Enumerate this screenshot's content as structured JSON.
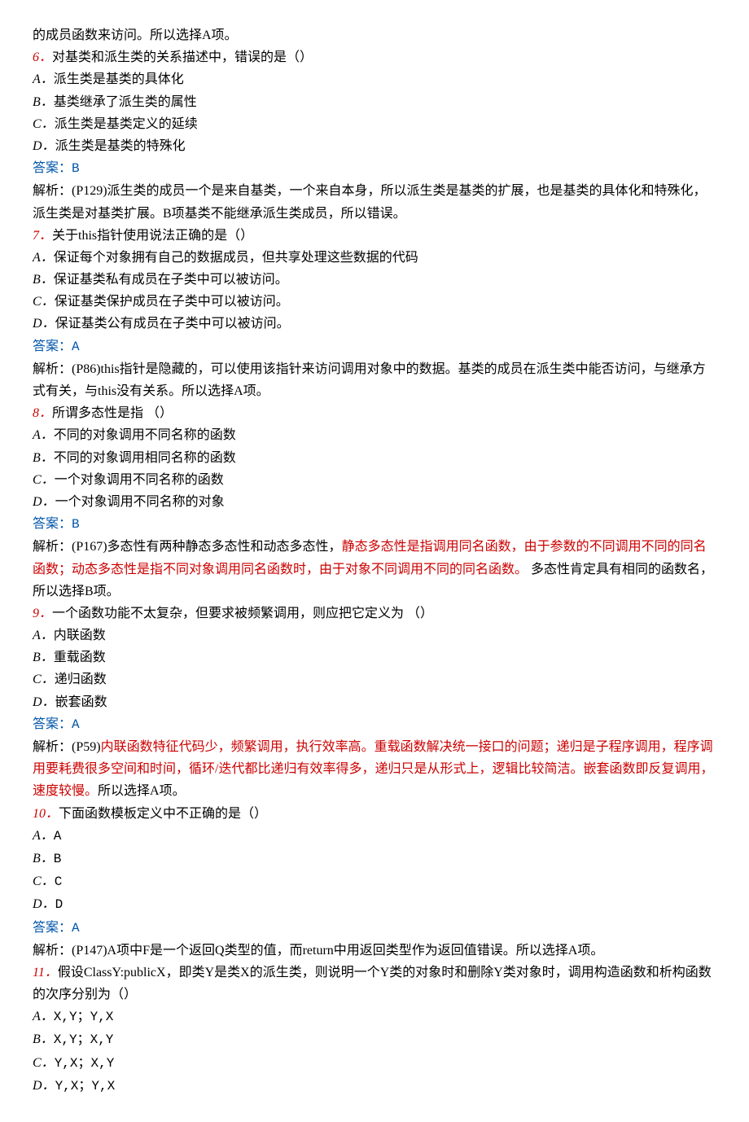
{
  "intro_tail": "的成员函数来访问。所以选择A项。",
  "q6": {
    "num": "6．",
    "stem": "对基类和派生类的关系描述中，错误的是（）",
    "A": "派生类是基类的具体化",
    "B": "基类继承了派生类的属性",
    "C": "派生类是基类定义的延续",
    "D": "派生类是基类的特殊化",
    "ans_label": "答案：",
    "ans_val": "B",
    "exp": "解析：(P129)派生类的成员一个是来自基类，一个来自本身，所以派生类是基类的扩展，也是基类的具体化和特殊化，派生类是对基类扩展。B项基类不能继承派生类成员，所以错误。"
  },
  "q7": {
    "num": "7．",
    "stem": "关于this指针使用说法正确的是（）",
    "A": "保证每个对象拥有自己的数据成员，但共享处理这些数据的代码",
    "B": "保证基类私有成员在子类中可以被访问。",
    "C": "保证基类保护成员在子类中可以被访问。",
    "D": "保证基类公有成员在子类中可以被访问。",
    "ans_label": "答案：",
    "ans_val": "A",
    "exp": "解析：(P86)this指针是隐藏的，可以使用该指针来访问调用对象中的数据。基类的成员在派生类中能否访问，与继承方式有关，与this没有关系。所以选择A项。"
  },
  "q8": {
    "num": "8．",
    "stem": "所谓多态性是指 （）",
    "A": "不同的对象调用不同名称的函数",
    "B": "不同的对象调用相同名称的函数",
    "C": "一个对象调用不同名称的函数",
    "D": "一个对象调用不同名称的对象",
    "ans_label": "答案：",
    "ans_val": "B",
    "exp_pre": "解析：(P167)多态性有两种静态多态性和动态多态性，",
    "exp_red": "静态多态性是指调用同名函数，由于参数的不同调用不同的同名函数；动态多态性是指不同对象调用同名函数时，由于对象不同调用不同的同名函数。",
    "exp_post": " 多态性肯定具有相同的函数名，所以选择B项。"
  },
  "q9": {
    "num": "9．",
    "stem": "一个函数功能不太复杂，但要求被频繁调用，则应把它定义为 （）",
    "A": "内联函数",
    "B": "重载函数",
    "C": "递归函数",
    "D": "嵌套函数",
    "ans_label": "答案：",
    "ans_val": "A",
    "exp_pre": "解析：(P59)",
    "exp_red": "内联函数特征代码少，频繁调用，执行效率高。重载函数解决统一接口的问题；递归是子程序调用，程序调用要耗费很多空间和时间，循环/迭代都比递归有效率得多，递归只是从形式上，逻辑比较简洁。嵌套函数即反复调用，速度较慢。",
    "exp_post": "所以选择A项。"
  },
  "q10": {
    "num": "10．",
    "stem": "下面函数模板定义中不正确的是（）",
    "A": "A",
    "B": "B",
    "C": "C",
    "D": "D",
    "ans_label": "答案：",
    "ans_val": "A",
    "exp": "解析：(P147)A项中F是一个返回Q类型的值，而return中用返回类型作为返回值错误。所以选择A项。"
  },
  "q11": {
    "num": "11．",
    "stem": "假设ClassY:publicX，即类Y是类X的派生类，则说明一个Y类的对象时和删除Y类对象时，调用构造函数和析构函数的次序分别为（）",
    "A": "X,Y；Y,X",
    "B": "X,Y；X,Y",
    "C": "Y,X；X,Y",
    "D": "Y,X；Y,X"
  },
  "letters": {
    "A": "A．",
    "B": "B．",
    "C": "C．",
    "D": "D．"
  }
}
